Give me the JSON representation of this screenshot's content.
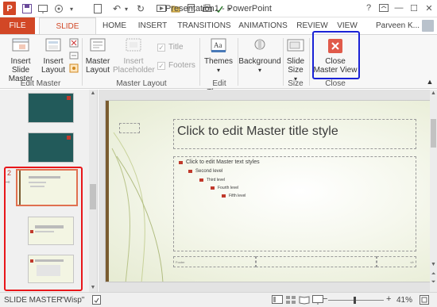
{
  "window": {
    "title": "Presentation1 - PowerPoint",
    "help": "?",
    "minimize": "—",
    "maximize": "☐",
    "close": "✕"
  },
  "quick_access": {
    "logo": "P",
    "save_icon": "save-icon",
    "undo": "↶",
    "redo": "↻"
  },
  "tabs": [
    {
      "label": "FILE"
    },
    {
      "label": "SLIDE MASTER"
    },
    {
      "label": "HOME"
    },
    {
      "label": "INSERT"
    },
    {
      "label": "TRANSITIONS"
    },
    {
      "label": "ANIMATIONS"
    },
    {
      "label": "REVIEW"
    },
    {
      "label": "VIEW"
    }
  ],
  "user": {
    "name": "Parveen K..."
  },
  "ribbon": {
    "edit_master": {
      "insert_slide_master": "Insert Slide Master",
      "insert_layout": "Insert Layout",
      "label": "Edit Master"
    },
    "master_layout": {
      "master_layout": "Master Layout",
      "insert_placeholder": "Insert Placeholder",
      "title": "Title",
      "footers": "Footers",
      "label": "Master Layout"
    },
    "edit_theme": {
      "themes": "Themes",
      "label": "Edit Theme"
    },
    "background": {
      "background": "Background"
    },
    "size": {
      "slide_size": "Slide Size",
      "label": "Size"
    },
    "close": {
      "close_master_view": "Close Master View",
      "label": "Close"
    }
  },
  "slide": {
    "title": "Click to edit Master title style",
    "levels": [
      "Click to edit Master text styles",
      "Second level",
      "Third level",
      "Fourth level",
      "Fifth level"
    ],
    "footer": "Footer",
    "slide_number": "‹#›"
  },
  "thumbnail_number": "2",
  "statusbar": {
    "view": "SLIDE MASTER",
    "theme": "\"Wisp\"",
    "zoom": "41%"
  }
}
